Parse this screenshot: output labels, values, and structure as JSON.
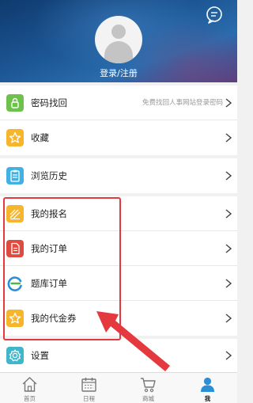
{
  "header": {
    "login_label": "登录/注册",
    "message_icon": "message-bubble-icon"
  },
  "menu": {
    "password_recovery": {
      "label": "密码找回",
      "hint": "免费找回人事网站登录密码",
      "icon": "lock-icon",
      "color": "#6cc24a"
    },
    "favorites": {
      "label": "收藏",
      "icon": "star-icon",
      "color": "#f7b52c"
    },
    "history": {
      "label": "浏览历史",
      "icon": "clipboard-icon",
      "color": "#3fb1e3"
    },
    "my_registration": {
      "label": "我的报名",
      "icon": "signup-icon",
      "color": "#f7b52c"
    },
    "my_orders": {
      "label": "我的订单",
      "icon": "order-icon",
      "color": "#e04b3f"
    },
    "question_bank_orders": {
      "label": "题库订单",
      "icon": "question-bank-icon",
      "color": "#2c8fd6"
    },
    "my_vouchers": {
      "label": "我的代金券",
      "icon": "voucher-star-icon",
      "color": "#f7b52c"
    },
    "settings": {
      "label": "设置",
      "icon": "gear-icon",
      "color": "#3fb6c9"
    }
  },
  "tabbar": {
    "tabs": [
      {
        "label": "首页",
        "icon": "home-icon"
      },
      {
        "label": "日程",
        "icon": "calendar-icon"
      },
      {
        "label": "商城",
        "icon": "cart-icon"
      },
      {
        "label": "我",
        "icon": "person-icon"
      }
    ],
    "active_index": 3,
    "active_color": "#2b8fd8"
  },
  "annotation": {
    "highlight_color": "#e4393f"
  }
}
